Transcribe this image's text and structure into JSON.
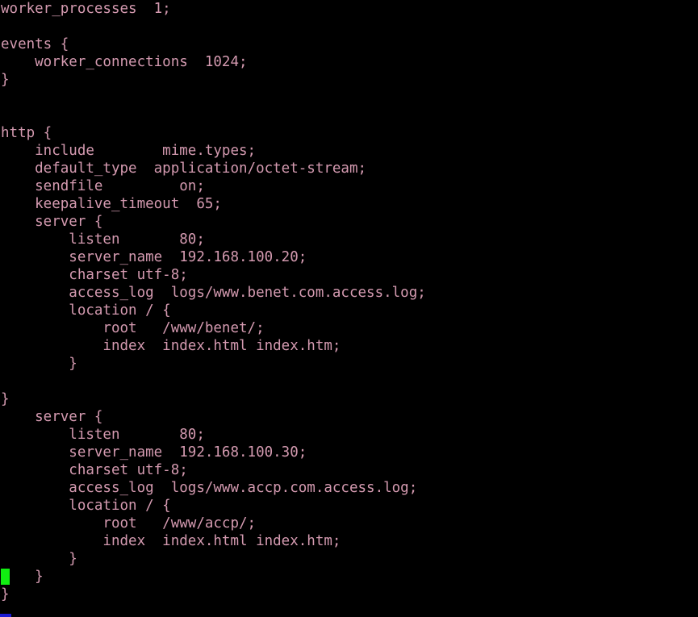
{
  "editor": {
    "background_color": "#000000",
    "text_color": "#d49ab0",
    "cursor_color": "#11ee11",
    "status_color": "#1b1bd2",
    "lines": [
      "worker_processes  1;",
      "",
      "events {",
      "    worker_connections  1024;",
      "}",
      "",
      "",
      "http {",
      "    include        mime.types;",
      "    default_type  application/octet-stream;",
      "    sendfile         on;",
      "    keepalive_timeout  65;",
      "    server {",
      "        listen       80;",
      "        server_name  192.168.100.20;",
      "        charset utf-8;",
      "        access_log  logs/www.benet.com.access.log;",
      "        location / {",
      "            root   /www/benet/;",
      "            index  index.html index.htm;",
      "        }",
      "",
      "}",
      "    server {",
      "        listen       80;",
      "        server_name  192.168.100.30;",
      "        charset utf-8;",
      "        access_log  logs/www.accp.com.access.log;",
      "        location / {",
      "            root   /www/accp/;",
      "            index  index.html index.htm;",
      "        }",
      "    }",
      "}",
      ""
    ],
    "cursor": {
      "line_index": 32,
      "column": 0
    }
  }
}
